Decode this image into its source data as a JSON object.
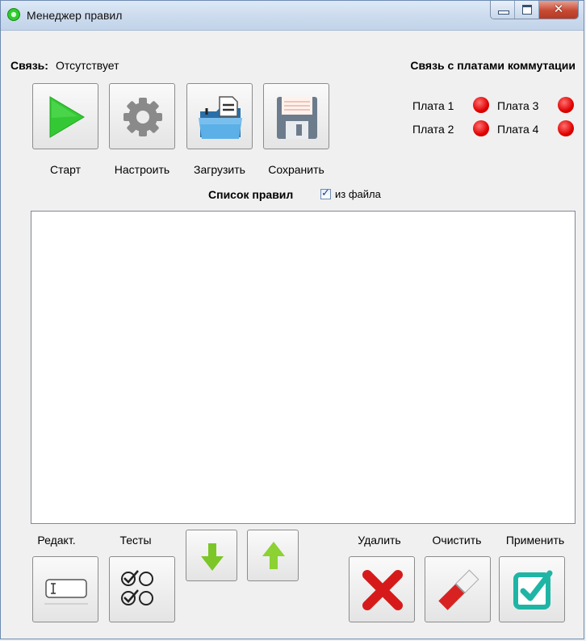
{
  "window": {
    "title": "Менеджер правил"
  },
  "connection": {
    "label": "Связь:",
    "value": "Отсутствует"
  },
  "boards": {
    "header": "Связь с платами коммутации",
    "items": [
      {
        "label": "Плата 1",
        "status_color": "#e00000"
      },
      {
        "label": "Плата 3",
        "status_color": "#e00000"
      },
      {
        "label": "Плата 2",
        "status_color": "#e00000"
      },
      {
        "label": "Плата 4",
        "status_color": "#e00000"
      }
    ]
  },
  "toolbar": {
    "start_label": "Старт",
    "configure_label": "Настроить",
    "load_label": "Загрузить",
    "save_label": "Сохранить"
  },
  "rules": {
    "title": "Список правил",
    "from_file_label": "из файла",
    "from_file_checked": true,
    "items": []
  },
  "bottom": {
    "edit_label": "Редакт.",
    "tests_label": "Тесты",
    "delete_label": "Удалить",
    "clear_label": "Очистить",
    "apply_label": "Применить"
  },
  "icons": {
    "start": "play-icon",
    "configure": "gear-icon",
    "load": "folder-open-icon",
    "save": "floppy-disk-icon",
    "edit": "text-field-icon",
    "tests": "checklist-icon",
    "move_down": "arrow-down-icon",
    "move_up": "arrow-up-icon",
    "delete": "red-x-icon",
    "clear": "eraser-icon",
    "apply": "checkbox-icon"
  },
  "colors": {
    "accent_green": "#2ec02e",
    "led_red": "#e00000",
    "apply_teal": "#1fb5a5"
  }
}
